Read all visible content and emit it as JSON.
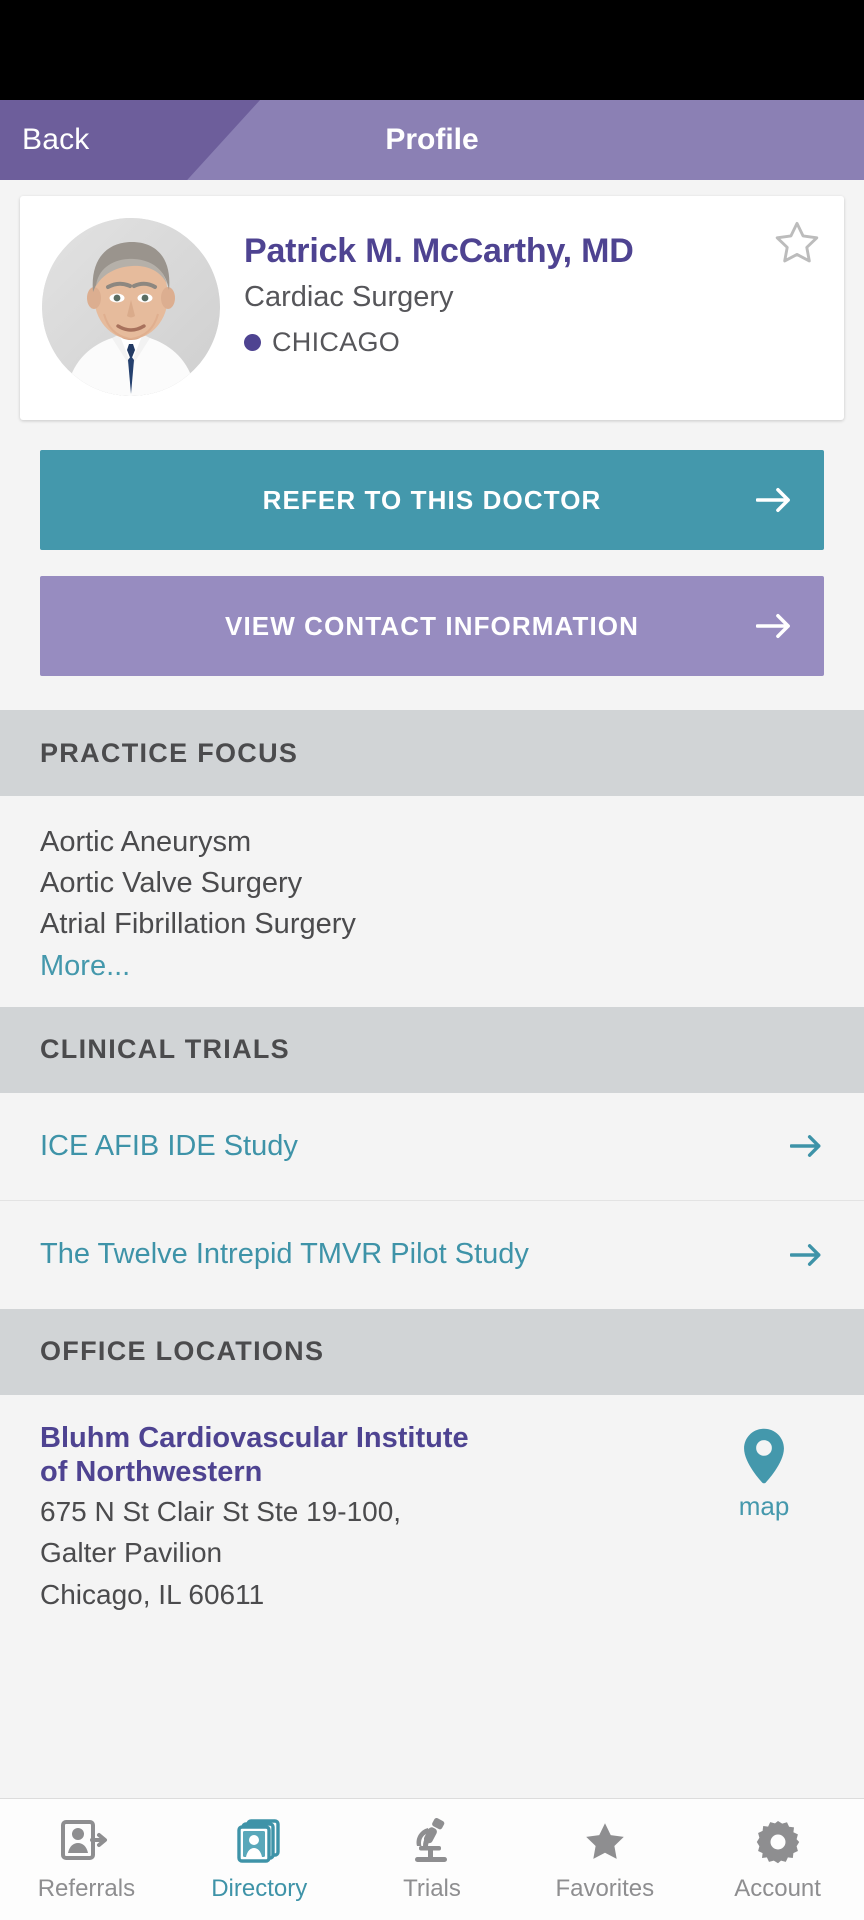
{
  "header": {
    "back_label": "Back",
    "title": "Profile",
    "back_bg": "#6d5e9b",
    "bar_bg": "#8b80b4"
  },
  "doctor": {
    "name": "Patrick M. McCarthy, MD",
    "specialty": "Cardiac Surgery",
    "location": "CHICAGO",
    "favorite_state": "off",
    "name_color": "#4e4391"
  },
  "actions": {
    "refer_label": "REFER TO THIS DOCTOR",
    "refer_color": "#4498ac",
    "contact_label": "VIEW CONTACT INFORMATION",
    "contact_color": "#978cc0"
  },
  "practice_focus": {
    "heading": "PRACTICE FOCUS",
    "items": [
      "Aortic Aneurysm",
      "Aortic Valve Surgery",
      "Atrial Fibrillation Surgery"
    ],
    "more_label": "More..."
  },
  "clinical_trials": {
    "heading": "CLINICAL TRIALS",
    "items": [
      {
        "name": "ICE AFIB IDE Study"
      },
      {
        "name": "The Twelve Intrepid TMVR Pilot Study"
      }
    ],
    "link_color": "#3e93a8"
  },
  "office_locations": {
    "heading": "OFFICE LOCATIONS",
    "items": [
      {
        "name_line1": "Bluhm Cardiovascular Institute",
        "name_line2": "of Northwestern",
        "addr_line1": "675 N St Clair St Ste 19-100,",
        "addr_line2": "Galter Pavilion",
        "addr_line3": "Chicago, IL 60611",
        "map_label": "map"
      }
    ]
  },
  "tabbar": {
    "active": "Directory",
    "items": [
      {
        "label": "Referrals",
        "icon": "referral-person-arrow-icon"
      },
      {
        "label": "Directory",
        "icon": "directory-cards-icon"
      },
      {
        "label": "Trials",
        "icon": "microscope-icon"
      },
      {
        "label": "Favorites",
        "icon": "star-icon"
      },
      {
        "label": "Account",
        "icon": "gear-icon"
      }
    ],
    "active_color": "#3e93a8",
    "inactive_color": "#8e8e90"
  }
}
